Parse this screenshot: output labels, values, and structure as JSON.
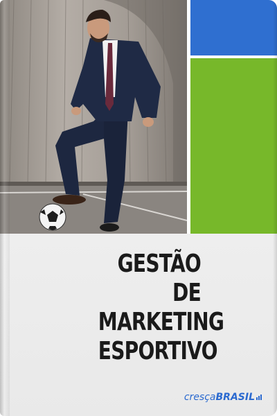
{
  "cover": {
    "title_lines": [
      "GESTÃO DE",
      "MARKETING",
      "ESPORTIVO"
    ],
    "brand": {
      "part1": "cresça",
      "part2": "BRASIL"
    },
    "colors": {
      "blue_block": "#2f6fd0",
      "green_block": "#77b82a",
      "title": "#1a1a1a",
      "brand": "#2b6ad0"
    },
    "photo": "businessman-with-soccer-ball-icon",
    "brand_icon": "signal-waves-icon"
  }
}
